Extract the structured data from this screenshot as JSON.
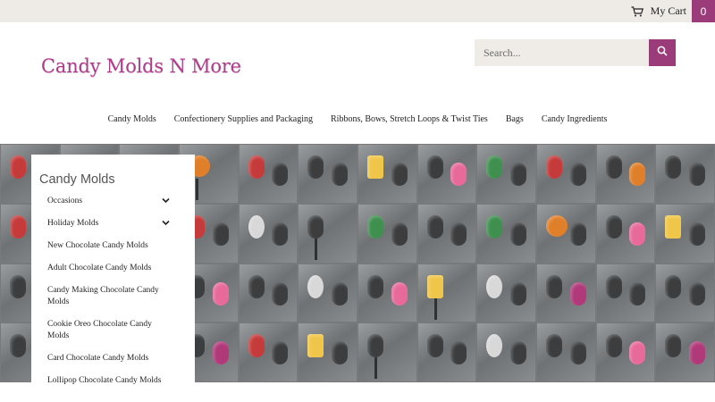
{
  "topbar": {
    "cart_label": "My Cart",
    "cart_count": "0",
    "cart_icon": "cart-icon"
  },
  "header": {
    "logo_text": "Candy Molds N More",
    "search_placeholder": "Search...",
    "search_icon": "search-icon"
  },
  "nav": {
    "items": [
      "Candy Molds",
      "Confectionery Supplies and Packaging",
      "Ribbons, Bows, Stretch Loops & Twist Ties",
      "Bags",
      "Candy Ingredients"
    ]
  },
  "sidebar": {
    "title": "Candy Molds",
    "items": [
      {
        "label": "Occasions",
        "expandable": true
      },
      {
        "label": "Holiday Molds",
        "expandable": true
      },
      {
        "label": "New Chocolate Candy Molds",
        "expandable": false
      },
      {
        "label": "Adult Chocolate Candy Molds",
        "expandable": false
      },
      {
        "label": "Candy Making Chocolate Candy Molds",
        "expandable": false
      },
      {
        "label": "Cookie Oreo Chocolate Candy Molds",
        "expandable": false
      },
      {
        "label": "Card Chocolate Candy Molds",
        "expandable": false
      },
      {
        "label": "Lollipop Chocolate Candy Molds",
        "expandable": false
      }
    ]
  },
  "colors": {
    "accent": "#9c3b7a",
    "logo": "#b23a8a",
    "topbar_bg": "#eeebe7"
  }
}
